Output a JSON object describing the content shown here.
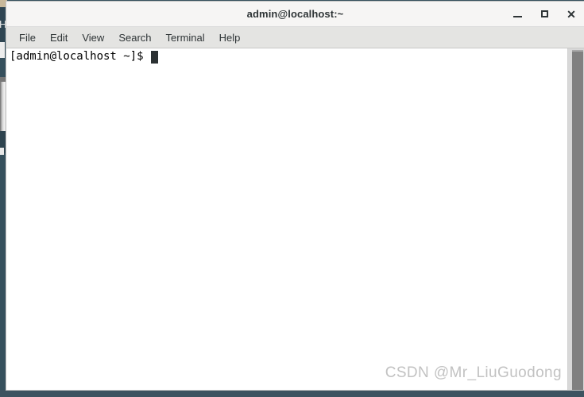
{
  "window": {
    "title": "admin@localhost:~",
    "controls": {
      "minimize_label": "–",
      "maximize_label": "",
      "close_label": "✕"
    }
  },
  "menubar": {
    "items": [
      {
        "label": "File",
        "name": "menu-file"
      },
      {
        "label": "Edit",
        "name": "menu-edit"
      },
      {
        "label": "View",
        "name": "menu-view"
      },
      {
        "label": "Search",
        "name": "menu-search"
      },
      {
        "label": "Terminal",
        "name": "menu-terminal"
      },
      {
        "label": "Help",
        "name": "menu-help"
      }
    ]
  },
  "terminal": {
    "lines": [
      {
        "text": "[admin@localhost ~]$",
        "has_cursor": true
      }
    ],
    "prompt": "[admin@localhost ~]$",
    "foreground_color": "#000000",
    "background_color": "#ffffff",
    "cursor_color": "#2b3133"
  },
  "background": {
    "desktop_color": "#36505d",
    "occluded_window_letter": "H"
  },
  "watermark": {
    "text": "CSDN @Mr_LiuGuodong"
  }
}
